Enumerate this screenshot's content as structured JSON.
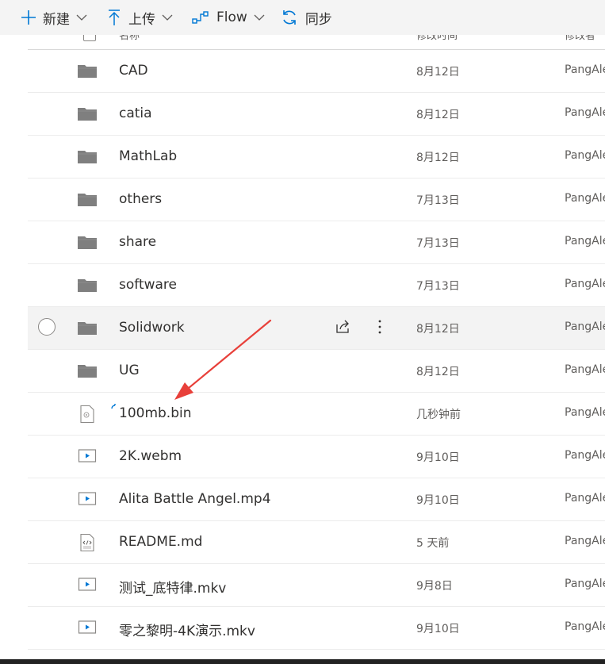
{
  "toolbar": {
    "new_label": "新建",
    "upload_label": "上传",
    "flow_label": "Flow",
    "sync_label": "同步"
  },
  "columns": {
    "name": "名称",
    "modified": "修改时间",
    "modified_by": "修改者"
  },
  "files": [
    {
      "name": "CAD",
      "modified": "8月12日",
      "owner": "PangAle",
      "type": "folder"
    },
    {
      "name": "catia",
      "modified": "8月12日",
      "owner": "PangAle",
      "type": "folder"
    },
    {
      "name": "MathLab",
      "modified": "8月12日",
      "owner": "PangAle",
      "type": "folder"
    },
    {
      "name": "others",
      "modified": "7月13日",
      "owner": "PangAle",
      "type": "folder"
    },
    {
      "name": "share",
      "modified": "7月13日",
      "owner": "PangAle",
      "type": "folder"
    },
    {
      "name": "software",
      "modified": "7月13日",
      "owner": "PangAle",
      "type": "folder"
    },
    {
      "name": "Solidwork",
      "modified": "8月12日",
      "owner": "PangAle",
      "type": "folder",
      "hovered": true
    },
    {
      "name": "UG",
      "modified": "8月12日",
      "owner": "PangAle",
      "type": "folder"
    },
    {
      "name": "100mb.bin",
      "modified": "几秒钟前",
      "owner": "PangAle",
      "type": "binary",
      "syncing": true
    },
    {
      "name": "2K.webm",
      "modified": "9月10日",
      "owner": "PangAle",
      "type": "video"
    },
    {
      "name": "Alita Battle Angel.mp4",
      "modified": "9月10日",
      "owner": "PangAle",
      "type": "video"
    },
    {
      "name": "README.md",
      "modified": "5 天前",
      "owner": "PangAle",
      "type": "code"
    },
    {
      "name": "测试_底特律.mkv",
      "modified": "9月8日",
      "owner": "PangAle",
      "type": "video"
    },
    {
      "name": "零之黎明-4K演示.mkv",
      "modified": "9月10日",
      "owner": "PangAle",
      "type": "video"
    }
  ],
  "colors": {
    "accent": "#0078d4",
    "folder": "#7f7f7f",
    "annotation_arrow": "#e8403a"
  }
}
